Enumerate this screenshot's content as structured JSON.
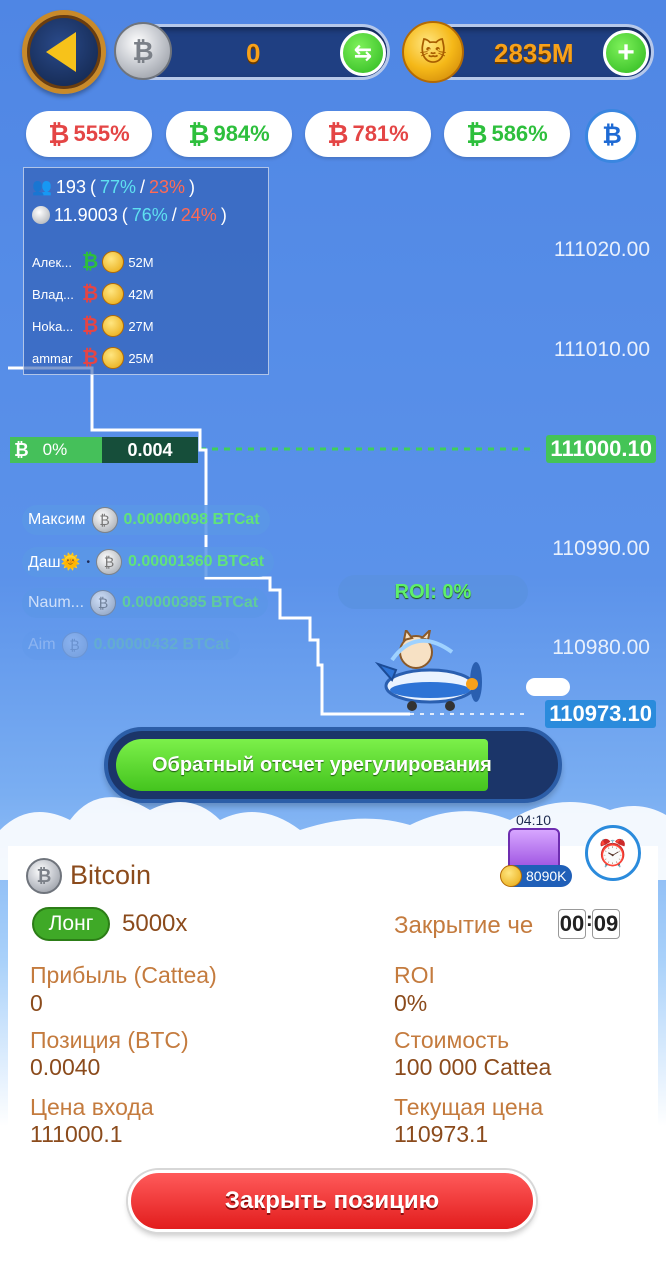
{
  "top_bar": {
    "balance_btc": "0",
    "balance_coins": "2835M"
  },
  "percent_pills": [
    {
      "direction": "down",
      "value": "555%"
    },
    {
      "direction": "up",
      "value": "984%"
    },
    {
      "direction": "down",
      "value": "781%"
    },
    {
      "direction": "up",
      "value": "586%"
    }
  ],
  "stats_panel": {
    "players_count": "193",
    "players_up": "77%",
    "players_down": "23%",
    "volume": "11.9003",
    "volume_up": "76%",
    "volume_down": "24%",
    "leaders": [
      {
        "name": "Алек...",
        "direction": "up",
        "amount": "52M"
      },
      {
        "name": "Влад...",
        "direction": "down",
        "amount": "42M"
      },
      {
        "name": "Hoka...",
        "direction": "down",
        "amount": "27M"
      },
      {
        "name": "ammar",
        "direction": "down",
        "amount": "25M"
      }
    ]
  },
  "chart": {
    "y_ticks": [
      "111020.00",
      "111010.00",
      "110990.00",
      "110980.00"
    ],
    "entry_price": "111000.10",
    "current_price": "110973.10",
    "entry_change": "0%",
    "entry_amount": "0.004",
    "roi_label": "ROI: 0%"
  },
  "trades": [
    {
      "name": "Максим",
      "amount": "0.00000098 BTCat"
    },
    {
      "name": "Даш🌞",
      "amount": "0.00001360 BTCat"
    },
    {
      "name": "Naum...",
      "amount": "0.00000385 BTCat"
    },
    {
      "name": "Aim",
      "amount": "0.00000432 BTCat"
    }
  ],
  "countdown": {
    "label": "Обратный отсчет урегулирования"
  },
  "chest": {
    "timer": "04:10",
    "value": "8090K"
  },
  "position": {
    "asset": "Bitcoin",
    "side": "Лонг",
    "leverage": "5000x",
    "close_in_label": "Закрытие че",
    "close_in_timer": [
      "00",
      "09"
    ],
    "profit_label": "Прибыль (Cattea)",
    "profit_value": "0",
    "roi_label": "ROI",
    "roi_value": "0%",
    "position_label": "Позиция (BTC)",
    "position_value": "0.0040",
    "cost_label": "Стоимость",
    "cost_value": "100 000 Cattea",
    "entry_label": "Цена входа",
    "entry_value": "111000.1",
    "current_label": "Текущая цена",
    "current_value": "110973.1",
    "close_button": "Закрыть позицию"
  },
  "colors": {
    "up": "#2dbf3c",
    "down": "#e44545",
    "accent_blue": "#2b8bdc",
    "close_red": "#e21d1d"
  }
}
